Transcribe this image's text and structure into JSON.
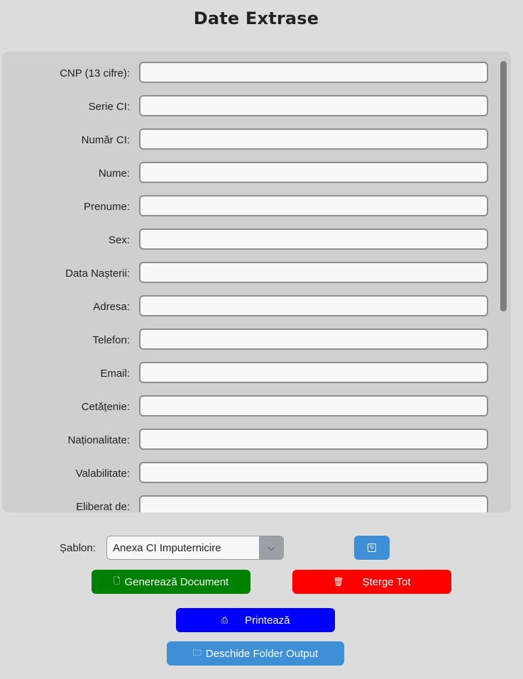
{
  "header": {
    "title": "Date Extrase"
  },
  "form": {
    "fields": [
      {
        "label": "CNP (13 cifre):",
        "value": ""
      },
      {
        "label": "Serie CI:",
        "value": ""
      },
      {
        "label": "Număr CI:",
        "value": ""
      },
      {
        "label": "Nume:",
        "value": ""
      },
      {
        "label": "Prenume:",
        "value": ""
      },
      {
        "label": "Sex:",
        "value": ""
      },
      {
        "label": "Data Nașterii:",
        "value": ""
      },
      {
        "label": "Adresa:",
        "value": ""
      },
      {
        "label": "Telefon:",
        "value": ""
      },
      {
        "label": "Email:",
        "value": ""
      },
      {
        "label": "Cetățenie:",
        "value": ""
      },
      {
        "label": "Naționalitate:",
        "value": ""
      },
      {
        "label": "Valabilitate:",
        "value": ""
      },
      {
        "label": "Eliberat de:",
        "value": ""
      }
    ]
  },
  "template": {
    "label": "Șablon:",
    "selected": "Anexa CI Imputernicire",
    "arrow_icon": "chevron-down-icon"
  },
  "buttons": {
    "refresh_icon": "refresh-icon",
    "generate_label": "Generează Document",
    "generate_icon": "document-icon",
    "clear_label": "Șterge Tot",
    "clear_icon": "trash-icon",
    "print_label": "Printează",
    "print_icon": "printer-icon",
    "folder_label": "Deschide Folder Output",
    "folder_icon": "folder-icon"
  },
  "colors": {
    "generate": "#008000",
    "clear": "#ff0000",
    "print": "#0000ff",
    "accent": "#3f8fd7"
  }
}
